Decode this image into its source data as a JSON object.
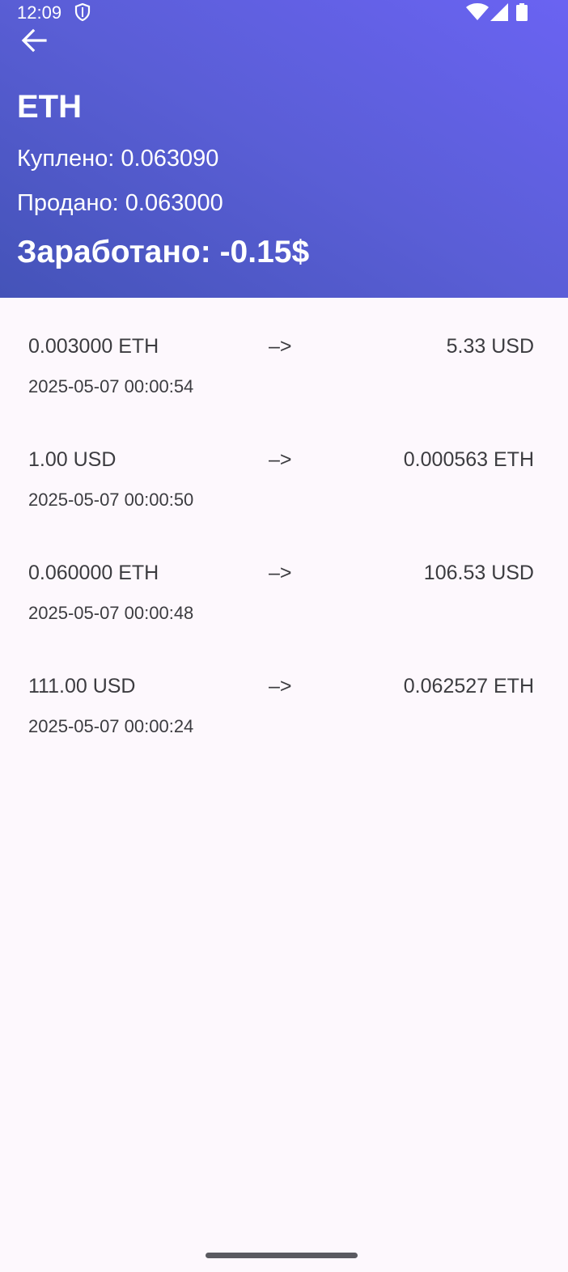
{
  "status_bar": {
    "time": "12:09",
    "icons": [
      "shield-icon",
      "wifi-icon",
      "signal-icon",
      "battery-icon"
    ]
  },
  "header": {
    "back_icon": "arrow-left-icon",
    "title": "ETH",
    "bought": "Куплено: 0.063090",
    "sold": "Продано: 0.063000",
    "earned": "Заработано: -0.15$",
    "gradient_colors": [
      "#4453b8",
      "#6a63f2"
    ]
  },
  "transactions": [
    {
      "from": "0.003000 ETH",
      "arrow": "–>",
      "to": "5.33 USD",
      "date": "2025-05-07 00:00:54"
    },
    {
      "from": "1.00 USD",
      "arrow": "–>",
      "to": "0.000563 ETH",
      "date": "2025-05-07 00:00:50"
    },
    {
      "from": "0.060000 ETH",
      "arrow": "–>",
      "to": "106.53 USD",
      "date": "2025-05-07 00:00:48"
    },
    {
      "from": "111.00 USD",
      "arrow": "–>",
      "to": "0.062527 ETH",
      "date": "2025-05-07 00:00:24"
    }
  ]
}
